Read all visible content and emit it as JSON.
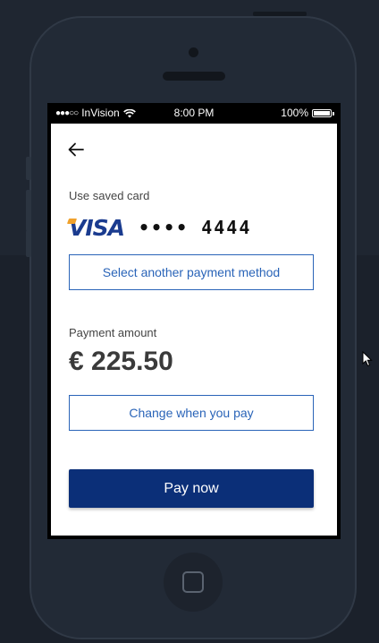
{
  "status_bar": {
    "signal": "●●●○○",
    "carrier": "InVision",
    "time": "8:00 PM",
    "battery_percent": "100%",
    "battery_level": 1.0
  },
  "screen": {
    "back_icon": "arrow-left-icon",
    "saved_card_label": "Use saved card",
    "card_brand": "VISA",
    "card_number": "•••• 4444",
    "select_method_label": "Select another payment method",
    "amount_label": "Payment amount",
    "amount_value": "€ 225.50",
    "change_label": "Change when you pay",
    "pay_label": "Pay now"
  },
  "colors": {
    "primary": "#0b2f78",
    "accent": "#2a64b8",
    "visa_blue": "#1a3b8f",
    "visa_gold": "#f0a12b",
    "background": "#1f2631"
  }
}
